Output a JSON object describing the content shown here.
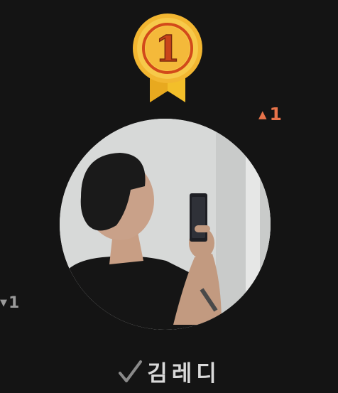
{
  "medal": {
    "rank_label": "1",
    "colors": {
      "gold": "#f2b631",
      "ribbon": "#f3bf2a",
      "inner": "#d24a1a"
    }
  },
  "rank_change_up": {
    "arrow": "▲",
    "value": "1",
    "color": "#e8734a"
  },
  "rank_change_down": {
    "arrow": "▼",
    "value": "1",
    "color": "#9a9a9a"
  },
  "profile": {
    "name": "김레디",
    "verified_icon": "check-icon"
  }
}
